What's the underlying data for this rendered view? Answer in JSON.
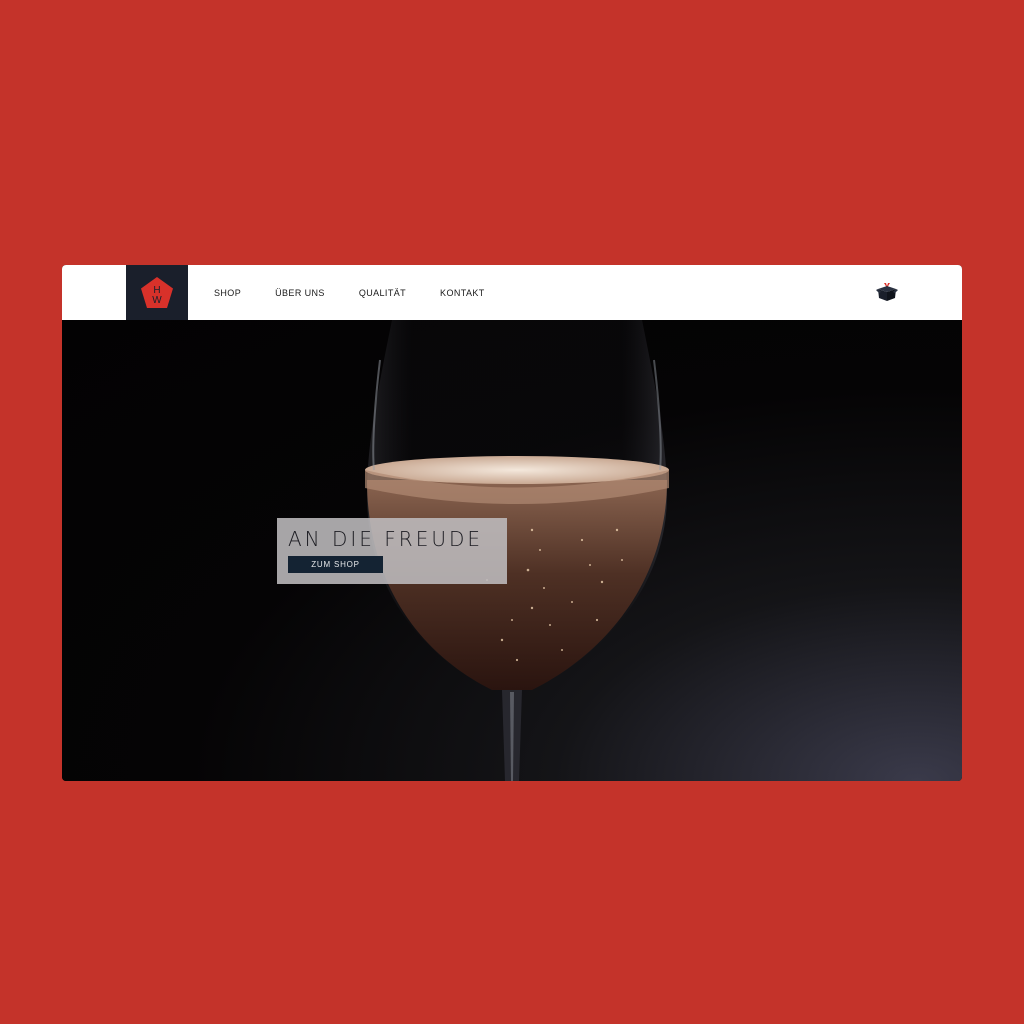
{
  "colors": {
    "page_background": "#c4332a",
    "navbar": "#ffffff",
    "logo_background": "#1a1f2b",
    "logo_red": "#d8312a",
    "hero_button": "#142333"
  },
  "brand": {
    "logo_letters": "HW",
    "logo_icon": "pentagon-logo-icon"
  },
  "nav": {
    "items": [
      {
        "label": "SHOP"
      },
      {
        "label": "ÜBER UNS"
      },
      {
        "label": "QUALITÄT"
      },
      {
        "label": "KONTAKT"
      }
    ],
    "cart_icon": "gift-box-cart-icon"
  },
  "hero": {
    "title": "AN DIE FREUDE",
    "button_label": "ZUM SHOP",
    "image": "sparkling-wine-glass"
  }
}
